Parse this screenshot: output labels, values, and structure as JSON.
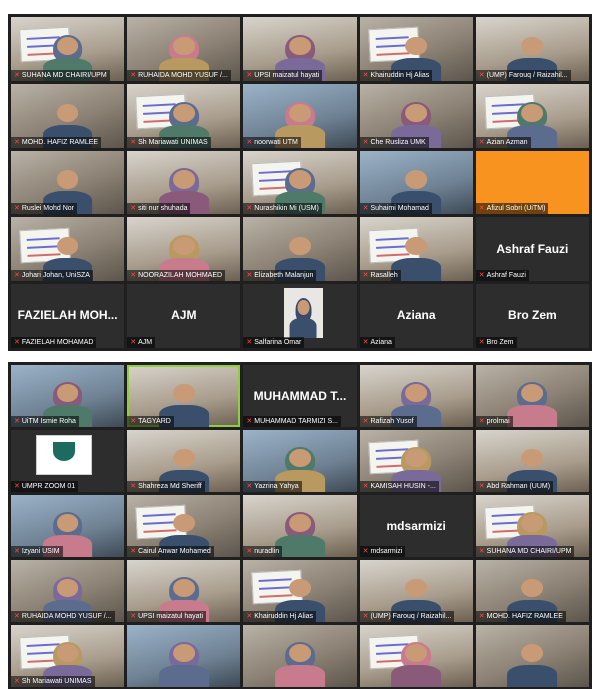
{
  "grids": [
    {
      "tiles": [
        {
          "name": "SUHANA MD CHAIRI/UPM",
          "type": "video",
          "style": "alt1",
          "skin": "hijab"
        },
        {
          "name": "RUHAIDA MOHD YUSUF /...",
          "type": "video",
          "style": "video",
          "skin": "hijab"
        },
        {
          "name": "UPSI maizatul hayati",
          "type": "video",
          "style": "alt1",
          "skin": "hijab"
        },
        {
          "name": "Khairuddin Hj Alias",
          "type": "video",
          "style": "video",
          "skin": "man"
        },
        {
          "name": "(UMP) Farouq / Raizahil...",
          "type": "video",
          "style": "alt1",
          "skin": "man"
        },
        {
          "name": "MOHD. HAFIZ RAMLEE",
          "type": "video",
          "style": "video",
          "skin": "man"
        },
        {
          "name": "Sh Mariawati UNIMAS",
          "type": "video",
          "style": "alt1",
          "skin": "hijab"
        },
        {
          "name": "noorwati UTM",
          "type": "video",
          "style": "alt2",
          "skin": "hijab"
        },
        {
          "name": "Che Rusliza UMK",
          "type": "video",
          "style": "video",
          "skin": "hijab"
        },
        {
          "name": "Azian Azman",
          "type": "video",
          "style": "alt1",
          "skin": "hijab"
        },
        {
          "name": "Ruslei Mohd Nor",
          "type": "video",
          "style": "video",
          "skin": "man"
        },
        {
          "name": "siti nur shuhada",
          "type": "video",
          "style": "alt1",
          "skin": "hijab"
        },
        {
          "name": "Nurashikin Mi (USM)",
          "type": "video",
          "style": "alt1",
          "skin": "hijab"
        },
        {
          "name": "Suhaimi Mohamad",
          "type": "video",
          "style": "alt2",
          "skin": "man"
        },
        {
          "name": "Afizul Sobri (UiTM)",
          "type": "orange",
          "style": "orange",
          "skin": "none"
        },
        {
          "name": "Johari Johan, UniSZA",
          "type": "video",
          "style": "video",
          "skin": "man"
        },
        {
          "name": "NOORAZILAH MOHMAED",
          "type": "video",
          "style": "alt1",
          "skin": "hijab"
        },
        {
          "name": "Elizabeth Malanjun",
          "type": "video",
          "style": "video",
          "skin": "man"
        },
        {
          "name": "Rasalleh",
          "type": "video",
          "style": "alt1",
          "skin": "man"
        },
        {
          "name": "Ashraf Fauzi",
          "type": "name",
          "big": "Ashraf Fauzi"
        },
        {
          "name": "FAZIELAH MOHAMAD",
          "type": "name",
          "big": "FAZIELAH MOH..."
        },
        {
          "name": "AJM",
          "type": "name",
          "big": "AJM"
        },
        {
          "name": "Salfarina Omar",
          "type": "smallcam"
        },
        {
          "name": "Aziana",
          "type": "name",
          "big": "Aziana"
        },
        {
          "name": "Bro Zem",
          "type": "name",
          "big": "Bro Zem"
        }
      ]
    },
    {
      "tiles": [
        {
          "name": "UiTM Ismie Roha",
          "type": "video",
          "style": "alt2",
          "skin": "hijab"
        },
        {
          "name": "TAGYARD",
          "type": "video",
          "style": "alt1",
          "skin": "man",
          "active": true
        },
        {
          "name": "MUHAMMAD TARMIZI S...",
          "type": "name",
          "big": "MUHAMMAD T..."
        },
        {
          "name": "Rafizah Yusof",
          "type": "video",
          "style": "alt1",
          "skin": "hijab"
        },
        {
          "name": "prolmai",
          "type": "video",
          "style": "video",
          "skin": "hijab"
        },
        {
          "name": "UMPR ZOOM 01",
          "type": "logo"
        },
        {
          "name": "Shahreza Md Sheriff",
          "type": "video",
          "style": "alt1",
          "skin": "man"
        },
        {
          "name": "Yazrina Yahya",
          "type": "video",
          "style": "alt2",
          "skin": "hijab"
        },
        {
          "name": "KAMISAH HUSIN -...",
          "type": "video",
          "style": "video",
          "skin": "hijab"
        },
        {
          "name": "Abd Rahman (UUM)",
          "type": "video",
          "style": "alt1",
          "skin": "man"
        },
        {
          "name": "Izyani USIM",
          "type": "video",
          "style": "alt2",
          "skin": "hijab"
        },
        {
          "name": "Cairul Anwar Mohamed",
          "type": "video",
          "style": "video",
          "skin": "man"
        },
        {
          "name": "nuradlin",
          "type": "video",
          "style": "alt1",
          "skin": "hijab"
        },
        {
          "name": "mdsarmizi",
          "type": "name",
          "big": "mdsarmizi"
        },
        {
          "name": "SUHANA MD CHAIRI/UPM",
          "type": "video",
          "style": "alt1",
          "skin": "hijab"
        },
        {
          "name": "RUHAIDA MOHD YUSUF /...",
          "type": "video",
          "style": "video",
          "skin": "hijab"
        },
        {
          "name": "UPSI maizatul hayati",
          "type": "video",
          "style": "alt1",
          "skin": "hijab"
        },
        {
          "name": "Khairuddin Hj Alias",
          "type": "video",
          "style": "video",
          "skin": "man"
        },
        {
          "name": "(UMP) Farouq / Raizahil...",
          "type": "video",
          "style": "alt1",
          "skin": "man"
        },
        {
          "name": "MOHD. HAFIZ RAMLEE",
          "type": "video",
          "style": "video",
          "skin": "man"
        },
        {
          "name": "Sh Mariawati UNIMAS",
          "type": "video",
          "style": "alt1",
          "skin": "hijab"
        },
        {
          "name": "",
          "type": "video",
          "style": "alt2",
          "skin": "hijab"
        },
        {
          "name": "",
          "type": "video",
          "style": "video",
          "skin": "hijab"
        },
        {
          "name": "",
          "type": "video",
          "style": "alt1",
          "skin": "hijab"
        },
        {
          "name": "",
          "type": "video",
          "style": "video",
          "skin": "man"
        }
      ]
    }
  ],
  "colors": {
    "mic_muted": "#ff4a4a",
    "active_speaker": "#8fce3c",
    "orange_tile": "#f7931e"
  }
}
